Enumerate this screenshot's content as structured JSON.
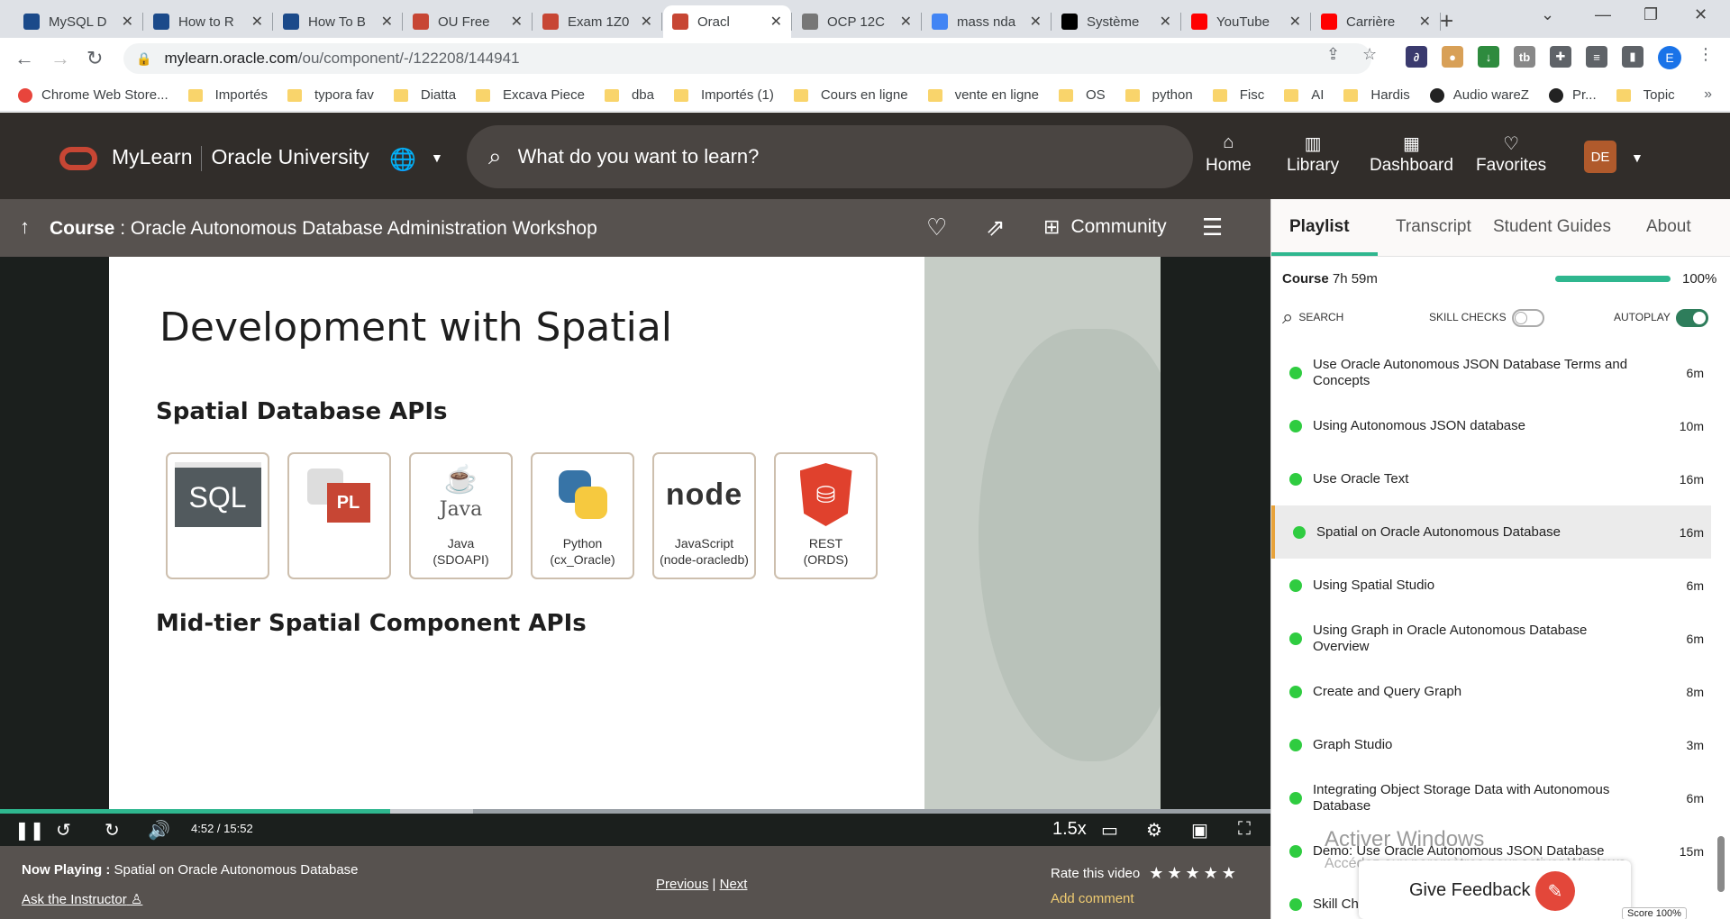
{
  "browser": {
    "tabs": [
      {
        "label": "MySQL D",
        "favicon_color": "#1b4a8a"
      },
      {
        "label": "How to R",
        "favicon_color": "#1b4a8a"
      },
      {
        "label": "How To B",
        "favicon_color": "#1b4a8a"
      },
      {
        "label": "OU Free",
        "favicon_color": "#c74634"
      },
      {
        "label": "Exam 1Z0",
        "favicon_color": "#c74634"
      },
      {
        "label": "Oracl",
        "favicon_color": "#c74634"
      },
      {
        "label": "OCP 12C",
        "favicon_color": "#777777"
      },
      {
        "label": "mass nda",
        "favicon_color": "#4285f4"
      },
      {
        "label": "Système",
        "favicon_color": "#000000"
      },
      {
        "label": "YouTube",
        "favicon_color": "#ff0000"
      },
      {
        "label": "Carrière",
        "favicon_color": "#ff0000"
      }
    ],
    "url_host": "mylearn.oracle.com",
    "url_path": "/ou/component/-/122208/144941",
    "profile_initial": "E",
    "bookmarks": [
      {
        "label": "Chrome Web Store...",
        "kind": "app"
      },
      {
        "label": "Importés",
        "kind": "folder"
      },
      {
        "label": "typora fav",
        "kind": "folder"
      },
      {
        "label": "Diatta",
        "kind": "folder"
      },
      {
        "label": "Excava Piece",
        "kind": "folder"
      },
      {
        "label": "dba",
        "kind": "folder"
      },
      {
        "label": "Importés (1)",
        "kind": "folder"
      },
      {
        "label": "Cours en ligne",
        "kind": "folder"
      },
      {
        "label": "vente en ligne",
        "kind": "folder"
      },
      {
        "label": "OS",
        "kind": "folder"
      },
      {
        "label": "python",
        "kind": "folder"
      },
      {
        "label": "Fisc",
        "kind": "folder"
      },
      {
        "label": "AI",
        "kind": "folder"
      },
      {
        "label": "Hardis",
        "kind": "folder"
      },
      {
        "label": "Audio wareZ",
        "kind": "site"
      },
      {
        "label": "Pr...",
        "kind": "site"
      },
      {
        "label": "Topic",
        "kind": "folder"
      }
    ]
  },
  "header": {
    "brand": "MyLearn",
    "brand_sub": "Oracle University",
    "search_placeholder": "What do you want to learn?",
    "nav": [
      {
        "label": "Home",
        "icon": "home-icon"
      },
      {
        "label": "Library",
        "icon": "library-icon"
      },
      {
        "label": "Dashboard",
        "icon": "dashboard-icon"
      },
      {
        "label": "Favorites",
        "icon": "heart-icon"
      }
    ],
    "avatar_initials": "DE"
  },
  "course": {
    "prefix": "Course",
    "title": ": Oracle Autonomous Database Administration Workshop",
    "community_label": "Community"
  },
  "slide": {
    "title": "Development with Spatial",
    "section1": "Spatial Database APIs",
    "section2": "Mid-tier Spatial Component APIs",
    "sql_text": "SQL",
    "pl_text": "PL",
    "java_logo": "Java",
    "node_logo": "node",
    "apis": [
      {
        "line1": "",
        "line2": ""
      },
      {
        "line1": "",
        "line2": ""
      },
      {
        "line1": "Java",
        "line2": "(SDOAPI)"
      },
      {
        "line1": "Python",
        "line2": "(cx_Oracle)"
      },
      {
        "line1": "JavaScript",
        "line2": "(node-oracledb)"
      },
      {
        "line1": "REST",
        "line2": "(ORDS)"
      }
    ]
  },
  "player": {
    "current_time": "4:52",
    "duration": "15:52",
    "played_fraction": 0.307,
    "buffered_fraction": 0.372,
    "speed": "1.5x"
  },
  "bottom": {
    "now_playing_label": "Now Playing :",
    "now_playing": "Spatial on Oracle Autonomous Database",
    "ask_instructor": "Ask the Instructor",
    "previous": "Previous",
    "separator": "|",
    "next": "Next",
    "rate_label": "Rate this video",
    "stars": "★★★★★",
    "add_comment": "Add comment"
  },
  "panel": {
    "tabs": [
      "Playlist",
      "Transcript",
      "Student Guides",
      "About"
    ],
    "course_label": "Course",
    "course_duration": "7h 59m",
    "progress_pct": "100%",
    "progress_fraction": 1.0,
    "search_label": "SEARCH",
    "skill_checks_label": "SKILL CHECKS",
    "autoplay_label": "AUTOPLAY",
    "items": [
      {
        "title": "Use Oracle Autonomous JSON Database Terms and Concepts",
        "duration": "6m"
      },
      {
        "title": "Using Autonomous JSON database",
        "duration": "10m"
      },
      {
        "title": "Use Oracle Text",
        "duration": "16m"
      },
      {
        "title": "Spatial on Oracle Autonomous Database",
        "duration": "16m",
        "current": true
      },
      {
        "title": "Using Spatial Studio",
        "duration": "6m"
      },
      {
        "title": "Using Graph in Oracle Autonomous Database Overview",
        "duration": "6m"
      },
      {
        "title": "Create and Query Graph",
        "duration": "8m"
      },
      {
        "title": "Graph Studio",
        "duration": "3m"
      },
      {
        "title": "Integrating Object Storage Data with Autonomous Database",
        "duration": "6m"
      },
      {
        "title": "Demo: Use Oracle Autonomous JSON Database",
        "duration": "15m"
      },
      {
        "title": "Skill Ch",
        "duration": ""
      }
    ],
    "score_chip": "Score 100%"
  },
  "overlay": {
    "watermark_title": "Activer Windows",
    "watermark_sub": "Accédez aux paramètres pour activer Windows.",
    "feedback_label": "Give Feedback"
  },
  "colors": {
    "oracle_red": "#c74634",
    "header_bg": "#312d2a",
    "bar_bg": "#57524f",
    "accent_green": "#2fb78f",
    "current_marker": "#e8a33b"
  }
}
